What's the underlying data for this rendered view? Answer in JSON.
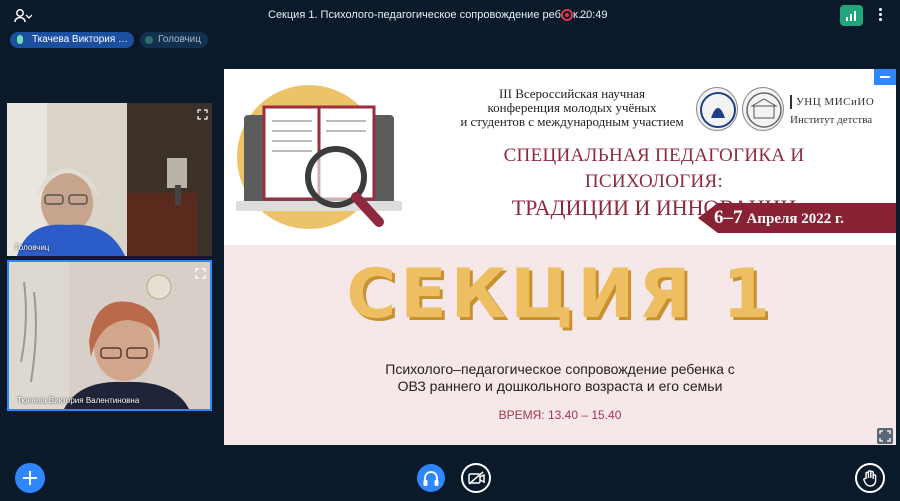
{
  "topbar": {
    "call_title": "Секция 1. Психолого-педагогическое сопровождение ребенк…",
    "recording_time": "20:49",
    "icons": {
      "participants": "people-icon",
      "signal": "signal-icon",
      "more": "more-vertical-icon"
    }
  },
  "speakers": [
    {
      "label": "Ткачева Виктория …",
      "status_color": "#6fe0b7"
    },
    {
      "label": "Головчиц"
    }
  ],
  "tiles": [
    {
      "name": "Головчиц"
    },
    {
      "name": "Ткачева Виктория Валентиновна"
    }
  ],
  "slide": {
    "conference_line1": "III Всероссийская научная",
    "conference_line2": "конференция молодых учёных",
    "conference_line3": "и студентов с международным участием",
    "org_name": "УНЦ МИСиИО",
    "org_subtitle": "Институт детства",
    "title_line1": "СПЕЦИАЛЬНАЯ ПЕДАГОГИКА И ПСИХОЛОГИЯ:",
    "title_line2": "ТРАДИЦИИ И ИННОВАЦИИ",
    "date_days": "6–7",
    "date_rest": "Апреля 2022 г.",
    "section_title": "СЕКЦИЯ 1",
    "subtitle_line1": "Психолого–педагогическое сопровождение ребенка с",
    "subtitle_line2": "ОВЗ раннего и дошкольного возраста и его семьи",
    "time": "ВРЕМЯ: 13.40 – 15.40"
  },
  "colors": {
    "background": "#0b1a2b",
    "accent": "#2f87ff",
    "recording": "#e2334a",
    "signal_good": "#1fa67a",
    "slide_maroon": "#8f2a3e",
    "slide_gold": "#edbf62"
  },
  "bottombar": {
    "icons": {
      "add": "plus-icon",
      "audio": "headphones-icon",
      "camera": "camera-off-icon",
      "hand": "raise-hand-icon"
    }
  }
}
